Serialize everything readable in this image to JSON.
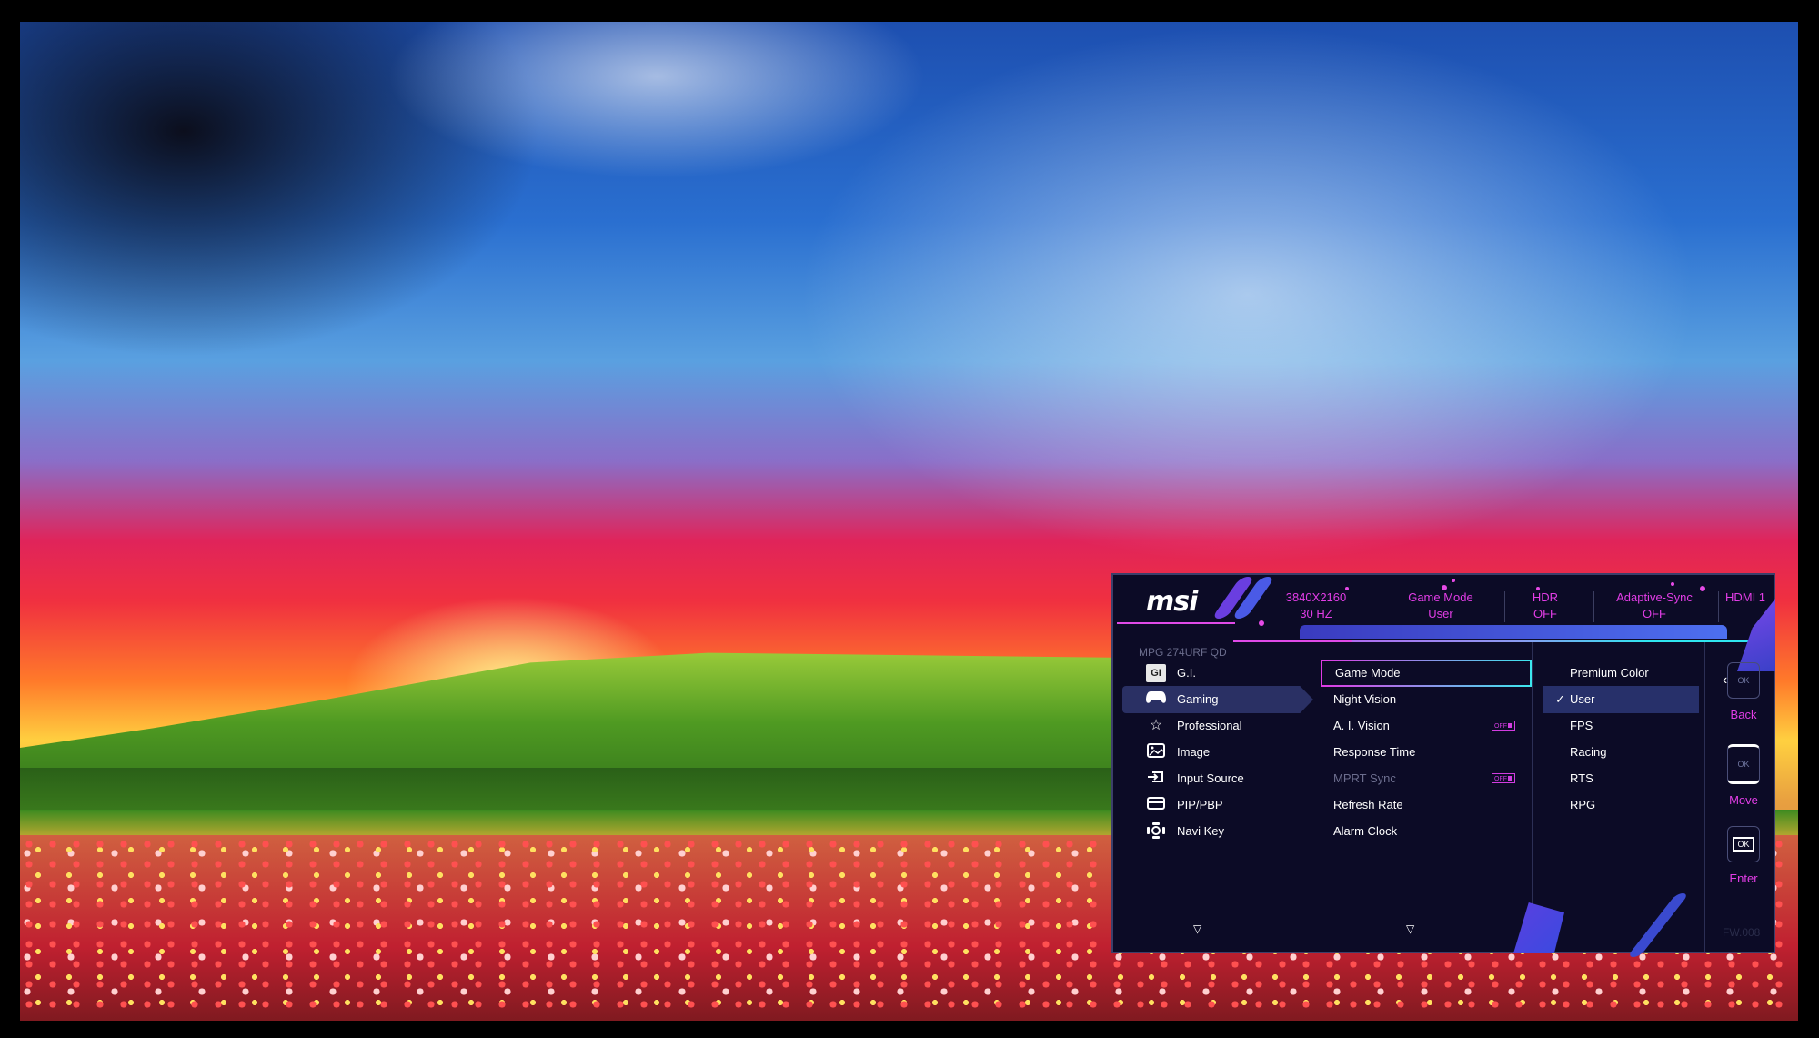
{
  "osd": {
    "brand": "msi",
    "model": "MPG 274URF QD",
    "status": [
      {
        "line1": "3840X2160",
        "line2": "30 HZ"
      },
      {
        "line1": "Game Mode",
        "line2": "User"
      },
      {
        "line1": "HDR",
        "line2": "OFF"
      },
      {
        "line1": "Adaptive-Sync",
        "line2": "OFF"
      },
      {
        "line1": "HDMI 1",
        "line2": ""
      }
    ],
    "nav": [
      {
        "label": "G.I.",
        "icon": "gi-icon",
        "active": false
      },
      {
        "label": "Gaming",
        "icon": "gamepad-icon",
        "active": true
      },
      {
        "label": "Professional",
        "icon": "star-icon",
        "active": false
      },
      {
        "label": "Image",
        "icon": "image-icon",
        "active": false
      },
      {
        "label": "Input Source",
        "icon": "input-source-icon",
        "active": false
      },
      {
        "label": "PIP/PBP",
        "icon": "pip-icon",
        "active": false
      },
      {
        "label": "Navi Key",
        "icon": "navi-key-icon",
        "active": false
      }
    ],
    "submenu": [
      {
        "label": "Game Mode",
        "focused": true
      },
      {
        "label": "Night Vision"
      },
      {
        "label": "A. I. Vision",
        "toggle": "OFF"
      },
      {
        "label": "Response Time"
      },
      {
        "label": "MPRT Sync",
        "toggle": "OFF",
        "disabled": true
      },
      {
        "label": "Refresh Rate"
      },
      {
        "label": "Alarm Clock"
      }
    ],
    "options": [
      {
        "label": "Premium Color"
      },
      {
        "label": "User",
        "selected": true
      },
      {
        "label": "FPS"
      },
      {
        "label": "Racing"
      },
      {
        "label": "RTS"
      },
      {
        "label": "RPG"
      }
    ],
    "keys": [
      {
        "label": "Back",
        "key": "OK"
      },
      {
        "label": "Move",
        "key": "OK"
      },
      {
        "label": "Enter",
        "key": "OK"
      }
    ],
    "firmware": "FW.008",
    "check_mark": "✓",
    "scroll_down": "▽",
    "colors": {
      "accent_pink": "#e23de6",
      "accent_cyan": "#2fe6f0",
      "panel_bg": "#0c0b26",
      "highlight": "#2a3064"
    }
  }
}
